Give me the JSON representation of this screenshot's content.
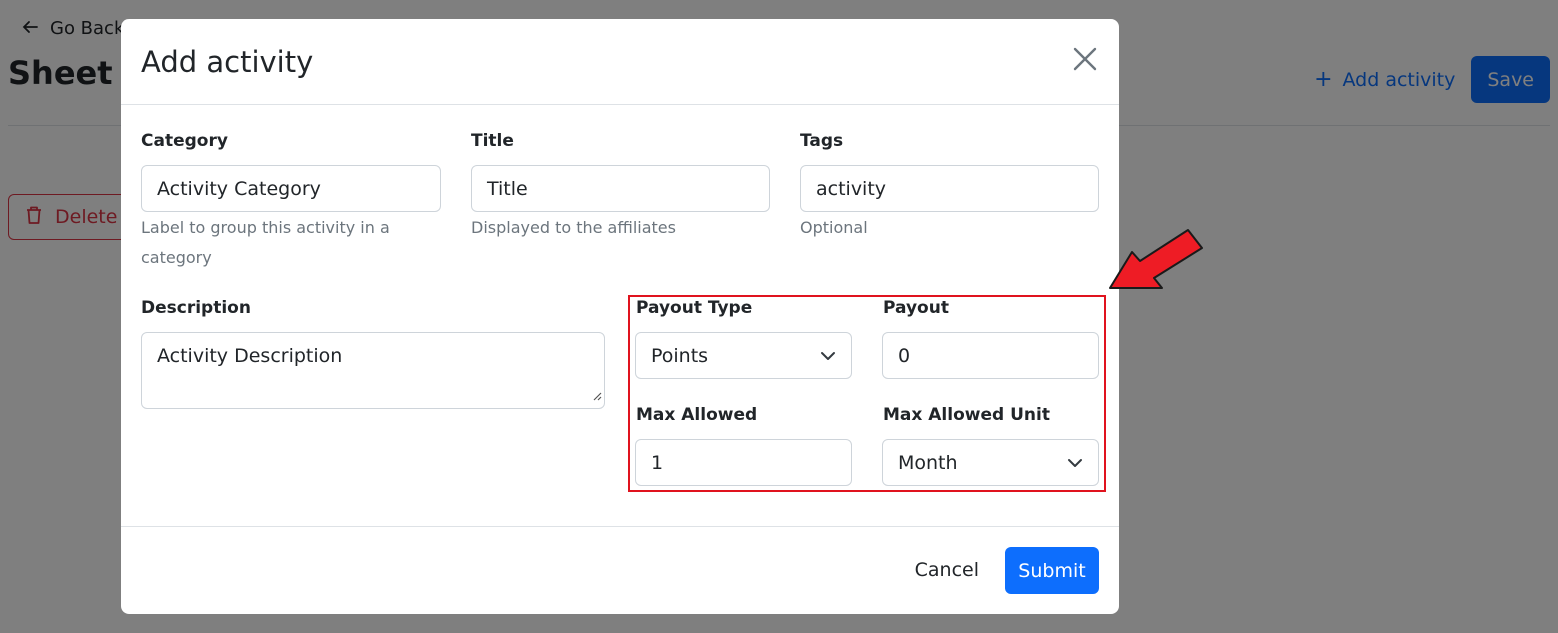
{
  "page": {
    "go_back": "Go Back",
    "sheet_title": "Sheet #",
    "add_activity": "Add activity",
    "save": "Save",
    "delete": "Delete"
  },
  "modal": {
    "title": "Add activity",
    "fields": {
      "category": {
        "label": "Category",
        "value": "Activity Category",
        "help": "Label to group this activity in a category"
      },
      "title": {
        "label": "Title",
        "value": "Title",
        "help": "Displayed to the affiliates"
      },
      "tags": {
        "label": "Tags",
        "value": "activity",
        "help": "Optional"
      },
      "description": {
        "label": "Description",
        "value": "Activity Description"
      },
      "payout_type": {
        "label": "Payout Type",
        "value": "Points"
      },
      "payout": {
        "label": "Payout",
        "value": "0"
      },
      "max_allowed": {
        "label": "Max Allowed",
        "value": "1"
      },
      "max_allowed_unit": {
        "label": "Max Allowed Unit",
        "value": "Month"
      }
    },
    "cancel": "Cancel",
    "submit": "Submit"
  },
  "colors": {
    "primary": "#0d6efd",
    "danger": "#dc3545",
    "highlight": "#e0131e",
    "annotation_arrow": "#ee1c25"
  },
  "icons": [
    "arrow-left-icon",
    "plus-icon",
    "trash-icon",
    "close-icon",
    "chevron-down-icon",
    "red-annotation-arrow"
  ]
}
